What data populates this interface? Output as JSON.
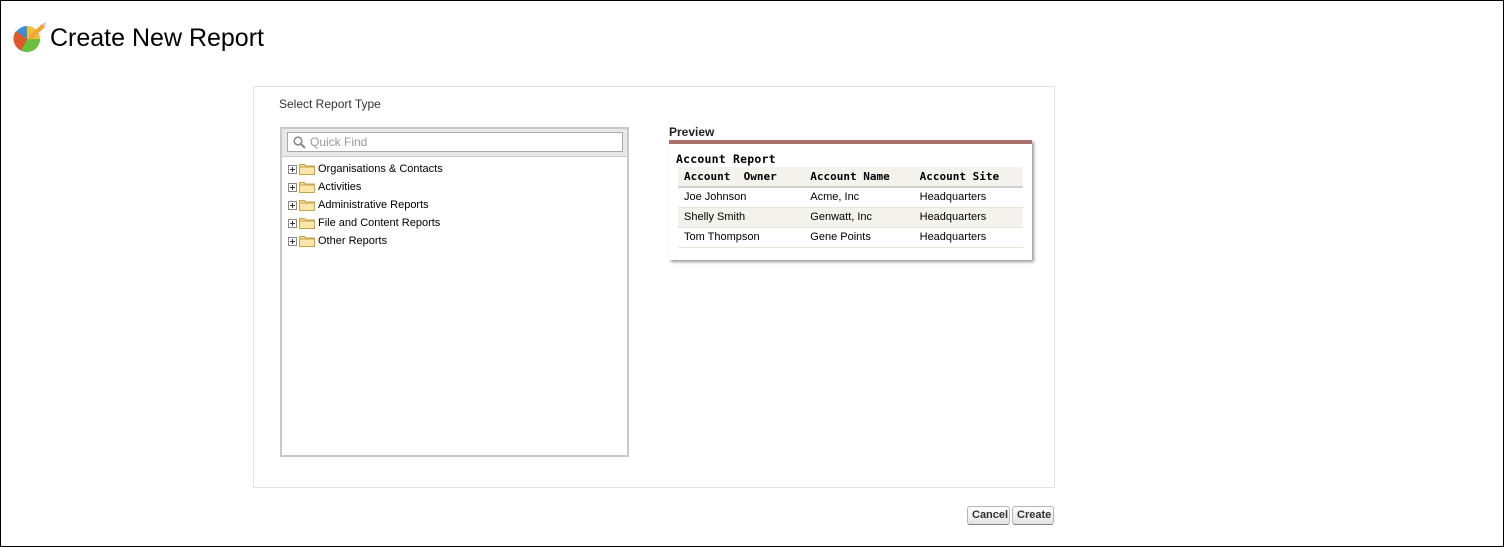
{
  "header": {
    "title": "Create New Report",
    "logo_icon": "report-chart-icon"
  },
  "panel": {
    "section_label": "Select Report Type",
    "search": {
      "placeholder": "Quick Find",
      "value": "",
      "icon": "search-icon"
    },
    "tree": [
      {
        "label": "Organisations & Contacts",
        "icon": "folder-icon"
      },
      {
        "label": "Activities",
        "icon": "folder-icon"
      },
      {
        "label": "Administrative Reports",
        "icon": "folder-icon"
      },
      {
        "label": "File and Content Reports",
        "icon": "folder-icon"
      },
      {
        "label": "Other Reports",
        "icon": "folder-icon"
      }
    ]
  },
  "preview": {
    "label": "Preview",
    "card_title": "Account Report",
    "columns": [
      "Account  Owner",
      "Account Name",
      "Account Site"
    ],
    "rows": [
      [
        "Joe Johnson",
        "Acme, Inc",
        "Headquarters"
      ],
      [
        "Shelly Smith",
        "Genwatt, Inc",
        "Headquarters"
      ],
      [
        "Tom Thompson",
        "Gene Points",
        "Headquarters"
      ]
    ],
    "accent_color": "#a8726a"
  },
  "actions": {
    "cancel_label": "Cancel",
    "create_label": "Create"
  }
}
